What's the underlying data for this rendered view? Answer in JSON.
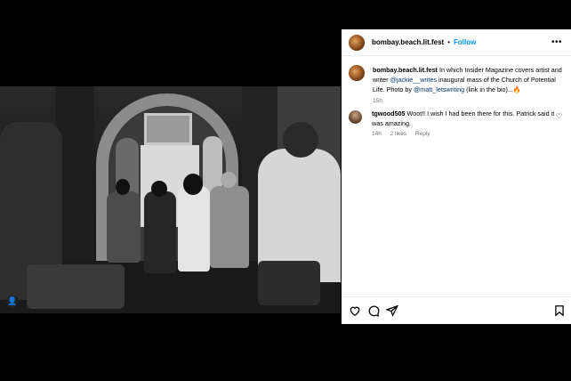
{
  "post": {
    "username": "bombay.beach.lit.fest",
    "separator": "•",
    "follow_label": "Follow",
    "more_label": "•••",
    "close_label": "✕"
  },
  "caption": {
    "username": "bombay.beach.lit.fest",
    "text_1": " In which Insider Magazine covers artist and writer ",
    "mention_1": "@jackie__writes",
    "text_2": " inaugural mass of the Church of Potential Life. Photo by ",
    "mention_2": "@matt_letswriting",
    "text_3": " (link in the bio)...🔥",
    "time": "15h"
  },
  "comment": {
    "username": "tgwood505",
    "text": " Woot!! I wish I had been there for this. Patrick said it was amazing.",
    "time": "14h",
    "likes": "2 likes",
    "reply_label": "Reply"
  },
  "photo": {
    "user_tag_icon": "👤"
  },
  "actions": {
    "icons": [
      "heart-icon",
      "comment-icon",
      "share-icon",
      "bookmark-icon"
    ]
  }
}
